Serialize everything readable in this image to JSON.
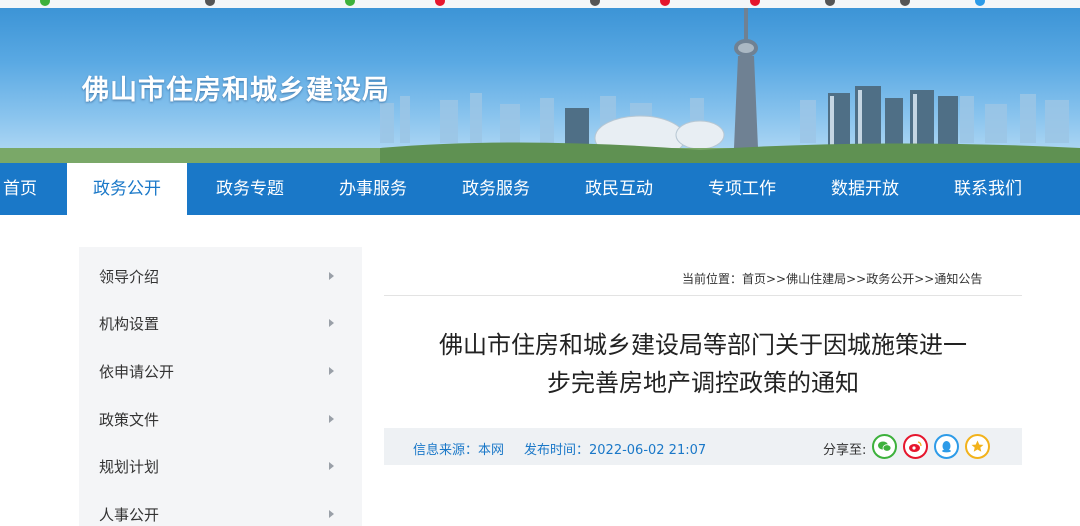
{
  "header": {
    "site_title": "佛山市住房和城乡建设局"
  },
  "nav": {
    "items": [
      {
        "label": "首页"
      },
      {
        "label": "政务公开"
      },
      {
        "label": "政务专题"
      },
      {
        "label": "办事服务"
      },
      {
        "label": "政务服务"
      },
      {
        "label": "政民互动"
      },
      {
        "label": "专项工作"
      },
      {
        "label": "数据开放"
      },
      {
        "label": "联系我们"
      }
    ],
    "active": "政务公开"
  },
  "sidebar": {
    "items": [
      {
        "label": "领导介绍"
      },
      {
        "label": "机构设置"
      },
      {
        "label": "依申请公开"
      },
      {
        "label": "政策文件"
      },
      {
        "label": "规划计划"
      },
      {
        "label": "人事公开"
      }
    ]
  },
  "breadcrumb": {
    "text": "当前位置：首页>>佛山住建局>>政务公开>>通知公告"
  },
  "article": {
    "title_line1": "佛山市住房和城乡建设局等部门关于因城施策进一",
    "title_line2": "步完善房地产调控政策的通知",
    "source": "信息来源：本网",
    "publish_time": "发布时间：2022-06-02 21:07",
    "share_label": "分享至:"
  },
  "share_icons": [
    "wechat-icon",
    "weibo-icon",
    "qq-icon",
    "qzone-icon"
  ],
  "colors": {
    "nav_bg": "#1a78c8",
    "accent": "#1a78c8",
    "wechat": "#3db13c",
    "weibo": "#e6162d",
    "qq": "#2d9be8",
    "qzone": "#f2b21b"
  }
}
